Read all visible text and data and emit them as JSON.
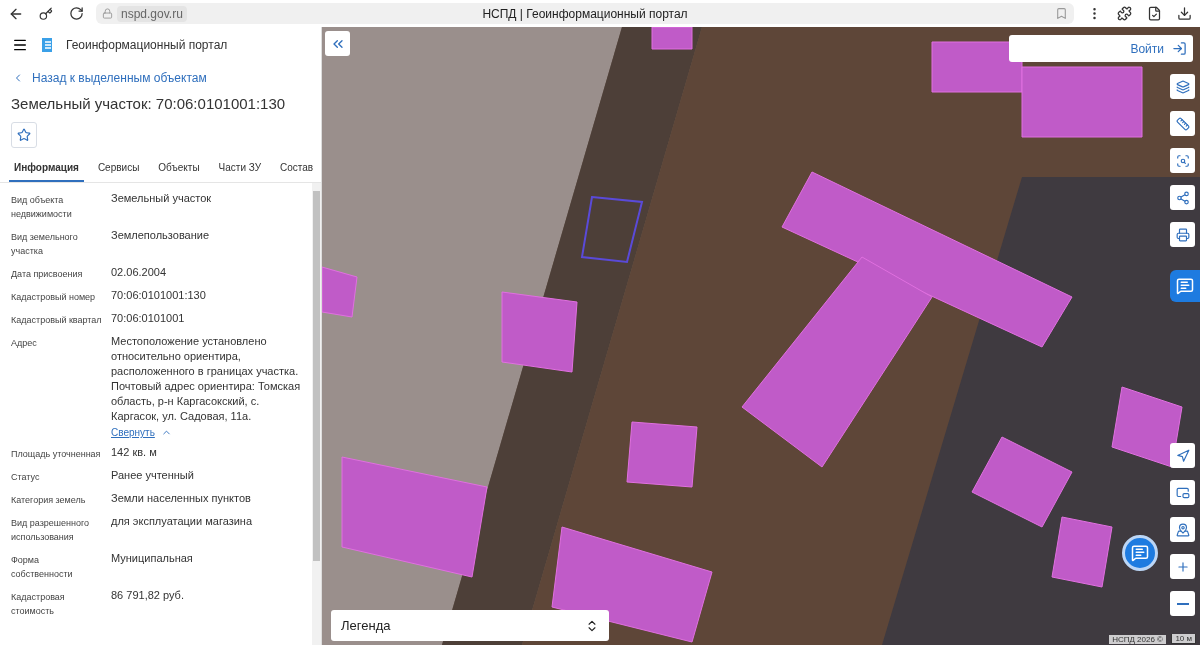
{
  "browser": {
    "url": "nspd.gov.ru",
    "title": "НСПД | Геоинформационный портал"
  },
  "sidebar": {
    "portal_title": "Геоинформационный портал",
    "back_link": "Назад к выделенным объектам",
    "heading": "Земельный участок: 70:06:0101001:130",
    "tabs": [
      {
        "label": "Информация",
        "selected": true
      },
      {
        "label": "Сервисы",
        "selected": false
      },
      {
        "label": "Объекты",
        "selected": false
      },
      {
        "label": "Части ЗУ",
        "selected": false
      },
      {
        "label": "Состав",
        "selected": false
      }
    ],
    "properties": [
      {
        "label": "Вид объекта недвижимости",
        "value": "Земельный участок"
      },
      {
        "label": "Вид земельного участка",
        "value": "Землепользование"
      },
      {
        "label": "Дата присвоения",
        "value": "02.06.2004"
      },
      {
        "label": "Кадастровый номер",
        "value": "70:06:0101001:130"
      },
      {
        "label": "Кадастровый квартал",
        "value": "70:06:0101001"
      },
      {
        "label": "Адрес",
        "value": "Местоположение установлено относительно ориентира, расположенного в границах участка. Почтовый адрес ориентира: Томская область, р-н Каргасокский, с. Каргасок, ул. Садовая, 11а.",
        "toggle": "Свернуть"
      },
      {
        "label": "Площадь уточненная",
        "value": "142 кв. м"
      },
      {
        "label": "Статус",
        "value": "Ранее учтенный"
      },
      {
        "label": "Категория земель",
        "value": "Земли населенных пунктов"
      },
      {
        "label": "Вид разрешенного использования",
        "value": "для эксплуатации магазина"
      },
      {
        "label": "Форма собственности",
        "value": "Муниципальная"
      },
      {
        "label": "Кадастровая стоимость",
        "value": "86 791,82 руб."
      }
    ]
  },
  "map": {
    "login": "Войти",
    "legend": "Легенда",
    "attribution": "НСПД 2026 ©",
    "scale": "10 м"
  }
}
